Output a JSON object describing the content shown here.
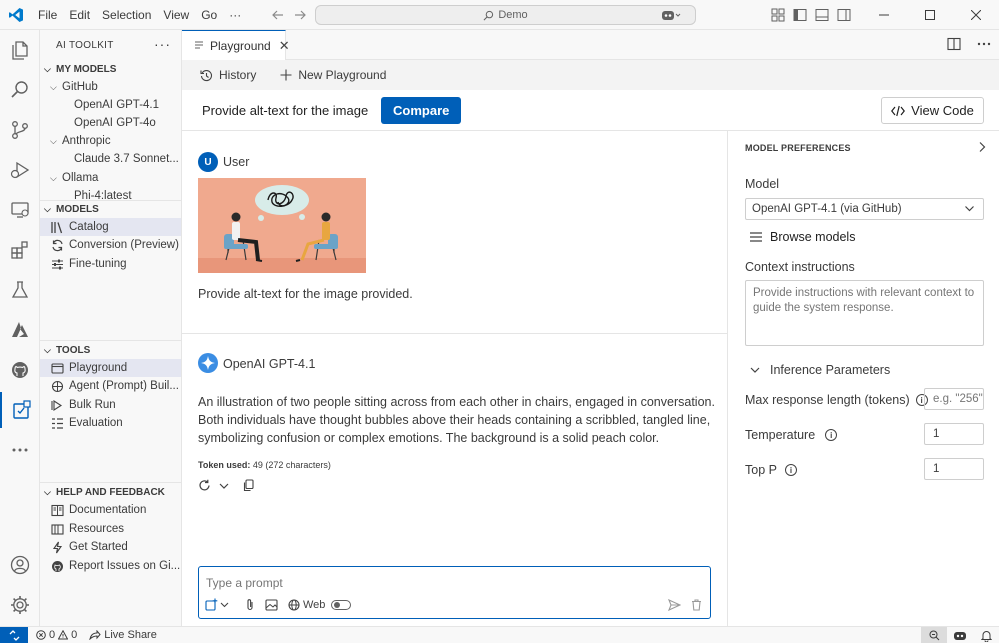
{
  "titlebar": {
    "menu": [
      "File",
      "Edit",
      "Selection",
      "View",
      "Go",
      "···"
    ],
    "search_text": "Demo"
  },
  "sidebar": {
    "title": "AI TOOLKIT",
    "more": "···",
    "my_models_header": "MY MODELS",
    "groups": [
      {
        "label": "GitHub",
        "items": [
          "OpenAI GPT-4.1",
          "OpenAI GPT-4o"
        ]
      },
      {
        "label": "Anthropic",
        "items": [
          "Claude 3.7 Sonnet..."
        ]
      },
      {
        "label": "Ollama",
        "items": [
          "Phi-4:latest"
        ]
      }
    ],
    "models_header": "MODELS",
    "models_items": [
      "Catalog",
      "Conversion (Preview)",
      "Fine-tuning"
    ],
    "tools_header": "TOOLS",
    "tools_items": [
      "Playground",
      "Agent (Prompt) Buil...",
      "Bulk Run",
      "Evaluation"
    ],
    "help_header": "HELP AND FEEDBACK",
    "help_items": [
      "Documentation",
      "Resources",
      "Get Started",
      "Report Issues on Gi..."
    ]
  },
  "tabs": {
    "active_label": "Playground",
    "close": "✕"
  },
  "toolbar": {
    "history_label": "History",
    "new_playground_label": "New Playground"
  },
  "compare_bar": {
    "title": "Provide alt-text for the image",
    "compare_label": "Compare",
    "view_code_label": "View Code"
  },
  "chat": {
    "user_initial": "U",
    "user_name": "User",
    "user_message": "Provide alt-text for the image provided.",
    "model_name": "OpenAI GPT-4.1",
    "answer": "An illustration of two people sitting across from each other in chairs, engaged in conversation. Both individuals have thought bubbles above their heads containing a scribbled, tangled line, symbolizing confusion or complex emotions. The background is a solid peach color.",
    "token_label": "Token used:",
    "token_value": "49 (272 characters)",
    "prompt_placeholder": "Type a prompt",
    "web_label": "Web"
  },
  "prefs": {
    "header": "MODEL PREFERENCES",
    "model_label": "Model",
    "model_value": "OpenAI GPT-4.1 (via GitHub)",
    "browse_label": "Browse models",
    "context_label": "Context instructions",
    "context_placeholder": "Provide instructions with relevant context to guide the system response.",
    "inference_label": "Inference Parameters",
    "max_resp_label": "Max response length (tokens)",
    "max_resp_placeholder": "e.g. \"256\"",
    "temperature_label": "Temperature",
    "temperature_value": "1",
    "top_p_label": "Top P",
    "top_p_value": "1"
  },
  "statusbar": {
    "errors": "0",
    "warnings": "0",
    "live_share": "Live Share"
  },
  "colors": {
    "accent": "#005fb8",
    "peach": "#f0a98e"
  }
}
